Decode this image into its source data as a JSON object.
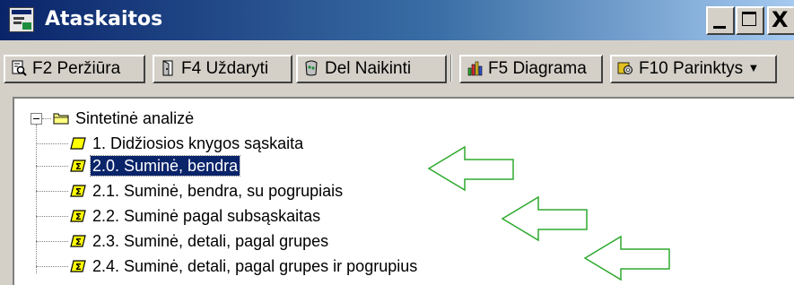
{
  "window": {
    "title": "Ataskaitos",
    "close_glyph": "X"
  },
  "toolbar": {
    "buttons": [
      {
        "label": "F2 Peržiūra",
        "icon": "preview-icon"
      },
      {
        "label": "F4 Uždaryti",
        "icon": "door-icon"
      },
      {
        "label": "Del Naikinti",
        "icon": "delete-icon"
      },
      {
        "label": "F5 Diagrama",
        "icon": "chart-icon"
      },
      {
        "label": "F10 Parinktys",
        "icon": "settings-icon",
        "dropdown": "▼"
      }
    ]
  },
  "tree": {
    "root": {
      "label": "Sintetinė analizė",
      "icon": "folder-icon"
    },
    "items": [
      {
        "label": "1. Didžiosios knygos sąskaita",
        "icon": "report-icon"
      },
      {
        "label": "2.0. Suminė, bendra",
        "icon": "report-summary-icon",
        "selected": true
      },
      {
        "label": "2.1. Suminė, bendra, su pogrupiais",
        "icon": "report-summary-icon"
      },
      {
        "label": "2.2. Suminė pagal subsąskaitas",
        "icon": "report-summary-icon"
      },
      {
        "label": "2.3. Suminė, detali, pagal grupes",
        "icon": "report-summary-icon"
      },
      {
        "label": "2.4. Suminė, detali, pagal grupes ir pogrupius",
        "icon": "report-summary-icon"
      }
    ]
  },
  "colors": {
    "title_bar": "#0a246a",
    "annotation_arrow": "#2eaa2e",
    "icon_yellow": "#ffff00"
  }
}
